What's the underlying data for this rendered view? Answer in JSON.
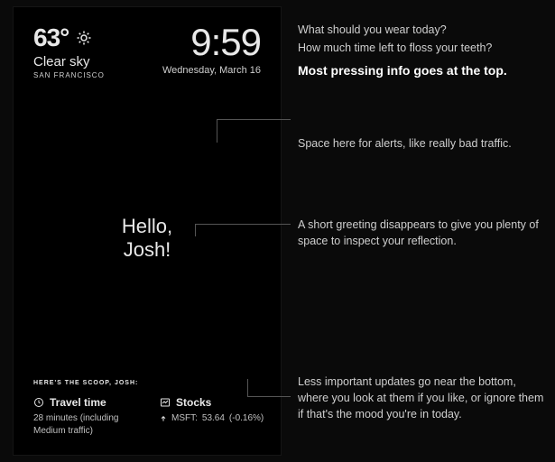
{
  "weather": {
    "temp": "63°",
    "condition": "Clear sky",
    "city": "SAN FRANCISCO"
  },
  "clock": {
    "time": "9:59",
    "date": "Wednesday, March 16"
  },
  "greeting": {
    "line1": "Hello,",
    "line2": "Josh!"
  },
  "scoop_label": "HERE'S THE SCOOP, JOSH:",
  "travel": {
    "title": "Travel time",
    "body": "28 minutes (including Medium traffic)"
  },
  "stocks": {
    "title": "Stocks",
    "symbol": "MSFT:",
    "price": "53.64",
    "change": "(-0.16%)"
  },
  "callouts": {
    "c1_l1": "What should you wear today?",
    "c1_l2": "How much time left to floss your teeth?",
    "c1_bold": "Most pressing info goes at the top.",
    "c2": "Space here for alerts, like really bad traffic.",
    "c3": "A short greeting disappears to give you plenty of space to inspect your reflection.",
    "c4": "Less important updates go near the bottom, where you look at them if you like, or ignore them if that's the mood you're in today."
  }
}
